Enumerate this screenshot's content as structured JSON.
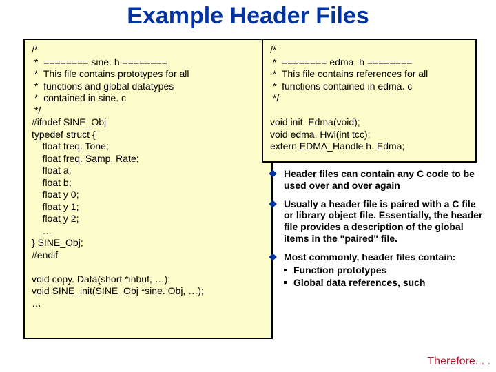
{
  "title": "Example Header Files",
  "leftCode": "/*\n *  ======== sine. h ========\n *  This file contains prototypes for all\n *  functions and global datatypes\n *  contained in sine. c\n */\n#ifndef SINE_Obj\ntypedef struct {\n    float freq. Tone;\n    float freq. Samp. Rate;\n    float a;\n    float b;\n    float y 0;\n    float y 1;\n    float y 2;\n    …\n} SINE_Obj;\n#endif\n\nvoid copy. Data(short *inbuf, …);\nvoid SINE_init(SINE_Obj *sine. Obj, …);\n…",
  "rightCode": "/*\n *  ======== edma. h ========\n *  This file contains references for all\n *  functions contained in edma. c\n */\n\nvoid init. Edma(void);\nvoid edma. Hwi(int tcc);\nextern EDMA_Handle h. Edma;",
  "bullets": {
    "b1": "Header files can contain any C code to be used over and over again",
    "b2": "Usually a header file is paired with a C file or library object file. Essentially, the header file provides a description of the global items in the \"paired\" file.",
    "b3": "Most commonly, header files contain:",
    "s1": "Function prototypes",
    "s2": "Global data references, such"
  },
  "therefore": "Therefore. . ."
}
